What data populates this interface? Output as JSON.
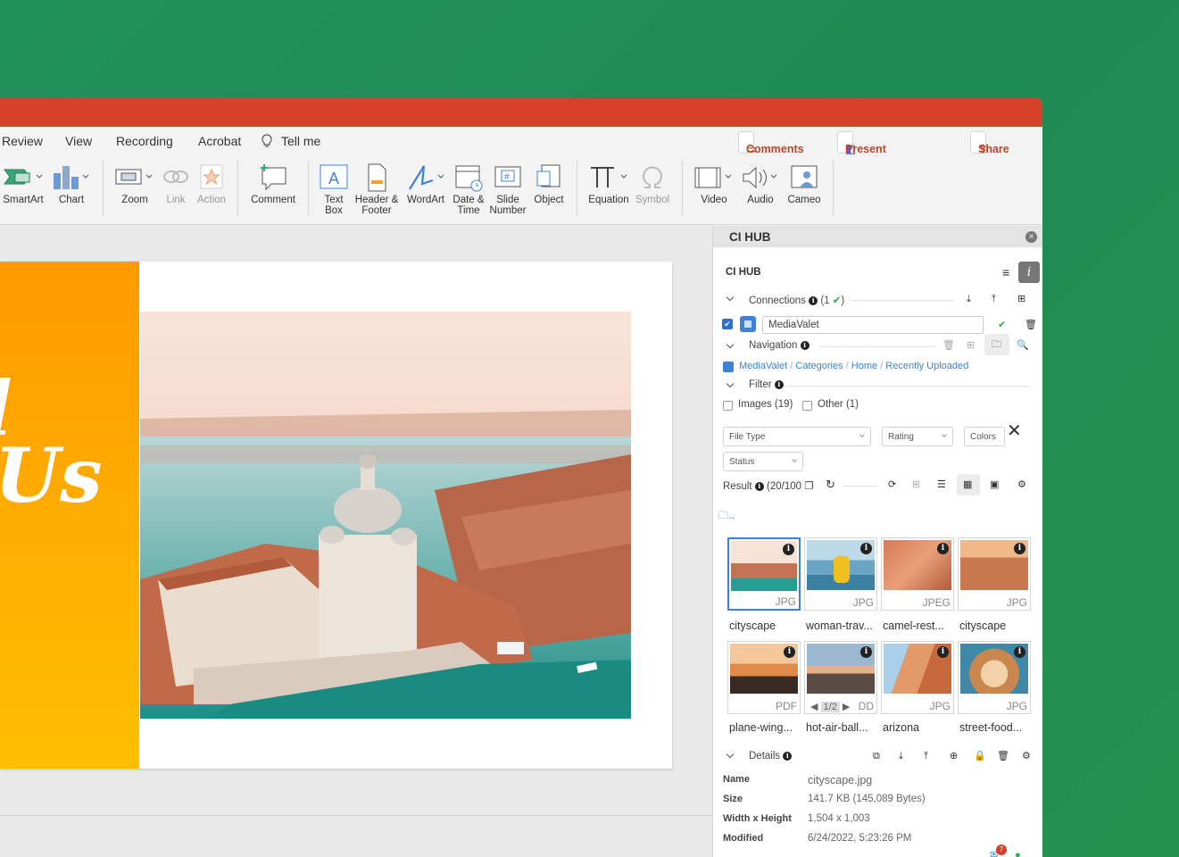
{
  "menu": {
    "items": [
      "Review",
      "View",
      "Recording",
      "Acrobat",
      "Tell me"
    ]
  },
  "ribbon": {
    "smartart": "SmartArt",
    "chart": "Chart",
    "zoom": "Zoom",
    "link": "Link",
    "action": "Action",
    "comment": "Comment",
    "textbox": [
      "Text",
      "Box"
    ],
    "header": [
      "Header &",
      "Footer"
    ],
    "wordart": "WordArt",
    "datetime": [
      "Date &",
      "Time"
    ],
    "slidenum": [
      "Slide",
      "Number"
    ],
    "object": "Object",
    "equation": "Equation",
    "symbol": "Symbol",
    "video": "Video",
    "audio": "Audio",
    "cameo": "Cameo"
  },
  "top_buttons": {
    "comments": "Comments",
    "present": "Present in Teams",
    "share": "Share"
  },
  "panel": {
    "title": "CI HUB",
    "subtitle": "CI HUB",
    "connections": {
      "label": "Connections",
      "count": "(1",
      "check": "✔",
      ")": ")"
    },
    "source": {
      "value": "MediaValet"
    },
    "navigation": {
      "label": "Navigation"
    },
    "breadcrumb": [
      "MediaValet",
      "Categories",
      "Home",
      "Recently Uploaded"
    ],
    "filter": {
      "label": "Filter",
      "images": "Images (19)",
      "other": "Other (1)"
    },
    "selects": {
      "file_type": "File Type",
      "rating": "Rating",
      "colors": "Colors",
      "status": "Status"
    },
    "result": {
      "label": "Result",
      "count": "(20/100"
    },
    "folder_up": "..",
    "thumbs": [
      {
        "name": "cityscape",
        "tag": "JPG"
      },
      {
        "name": "woman-trav...",
        "tag": "JPG"
      },
      {
        "name": "camel-rest...",
        "tag": "JPEG"
      },
      {
        "name": "cityscape",
        "tag": "JPG"
      },
      {
        "name": "plane-wing...",
        "tag": "PDF"
      },
      {
        "name": "hot-air-ball...",
        "tag": "DD",
        "pager": "1/2"
      },
      {
        "name": "arizona",
        "tag": "JPG"
      },
      {
        "name": "street-food...",
        "tag": "JPG"
      }
    ],
    "details": {
      "label": "Details",
      "name_label": "Name",
      "name": "cityscape.jpg",
      "size_label": "Size",
      "size": "141.7 KB (145,089 Bytes)",
      "wh_label": "Width x Height",
      "wh": "1,504 x 1,003",
      "mod_label": "Modified",
      "mod": "6/24/2022, 5:23:26 PM"
    },
    "notify_count": "7"
  },
  "colors": {
    "accent": "#d6412a",
    "link": "#3b82d8",
    "slide_orange": "#ff9a00"
  }
}
